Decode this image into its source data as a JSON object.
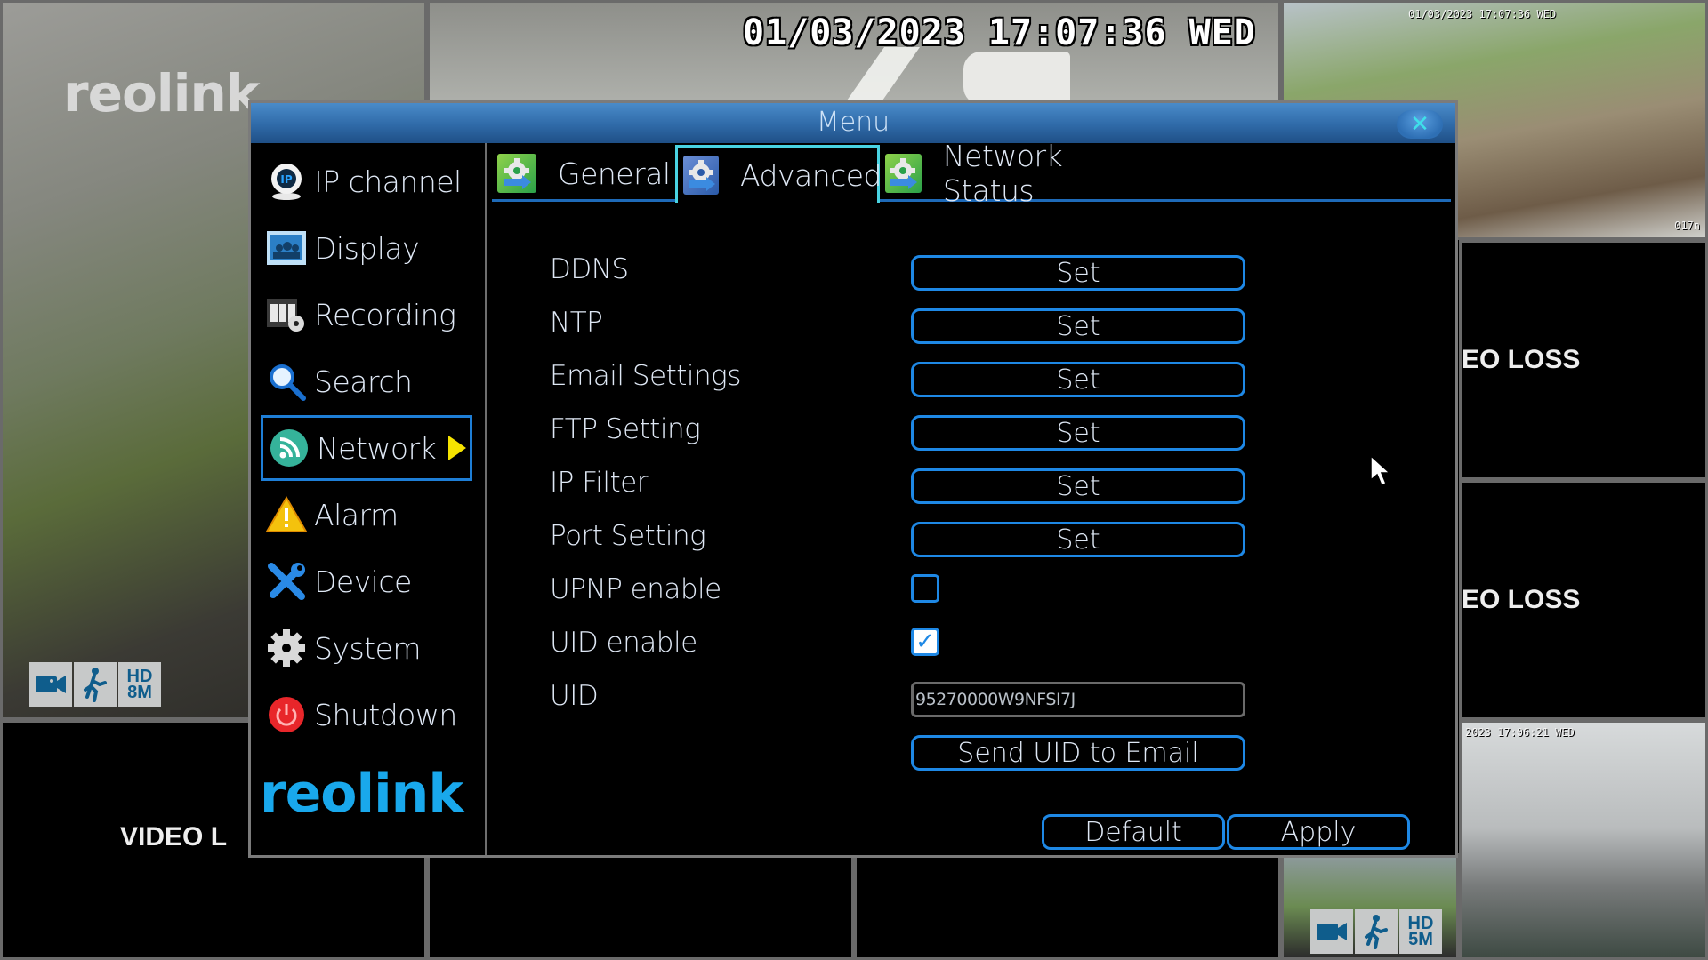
{
  "background": {
    "osd_datetime": "01/03/2023 17:07:36 WED",
    "watermark_logo": "reolink",
    "feed3_osd_datetime": "01/03/2023 17:07:36 WED",
    "feed3_channel_label": "017n",
    "feed_br_osd_datetime": "2023 17:06:21 WED",
    "video_loss_label": "VIDEO LOSS",
    "video_loss_label_r1": "EO LOSS",
    "video_loss_label_r2": "EO LOSS",
    "video_loss_label_bl": "VIDEO L",
    "feed1_badges": {
      "camera": "camera-icon",
      "motion": "motion-icon",
      "resolution": "HD 8M"
    },
    "feed_br_badges": {
      "camera": "camera-icon",
      "motion": "motion-icon",
      "resolution": "HD 5M"
    }
  },
  "menu": {
    "title": "Menu",
    "close_icon": "close-icon",
    "sidebar": {
      "items": [
        {
          "label": "IP channel",
          "icon": "ip-camera-icon",
          "active": false
        },
        {
          "label": "Display",
          "icon": "display-icon",
          "active": false
        },
        {
          "label": "Recording",
          "icon": "recording-icon",
          "active": false
        },
        {
          "label": "Search",
          "icon": "search-icon",
          "active": false
        },
        {
          "label": "Network",
          "icon": "network-icon",
          "active": true
        },
        {
          "label": "Alarm",
          "icon": "alarm-icon",
          "active": false
        },
        {
          "label": "Device",
          "icon": "device-icon",
          "active": false
        },
        {
          "label": "System",
          "icon": "system-icon",
          "active": false
        },
        {
          "label": "Shutdown",
          "icon": "shutdown-icon",
          "active": false
        }
      ],
      "brand": "reolink"
    },
    "tabs": [
      {
        "label": "General",
        "active": false
      },
      {
        "label": "Advanced",
        "active": true
      },
      {
        "label": "Network Status",
        "active": false
      }
    ],
    "settings": {
      "rows": [
        {
          "label": "DDNS",
          "control": "button",
          "button_label": "Set"
        },
        {
          "label": "NTP",
          "control": "button",
          "button_label": "Set"
        },
        {
          "label": "Email Settings",
          "control": "button",
          "button_label": "Set"
        },
        {
          "label": "FTP Setting",
          "control": "button",
          "button_label": "Set"
        },
        {
          "label": "IP Filter",
          "control": "button",
          "button_label": "Set"
        },
        {
          "label": "Port Setting",
          "control": "button",
          "button_label": "Set"
        },
        {
          "label": "UPNP enable",
          "control": "checkbox",
          "checked": false
        },
        {
          "label": "UID enable",
          "control": "checkbox",
          "checked": true
        },
        {
          "label": "UID",
          "control": "text",
          "value": "95270000W9NFSI7J"
        }
      ],
      "send_uid_button": "Send UID to Email"
    },
    "footer": {
      "default_label": "Default",
      "apply_label": "Apply"
    }
  },
  "colors": {
    "accent_blue": "#1e88e5",
    "title_bar": "#2f6aa8",
    "active_tab_border": "#49d3e2",
    "active_arrow": "#f5e300",
    "brand": "#19a8ec"
  }
}
